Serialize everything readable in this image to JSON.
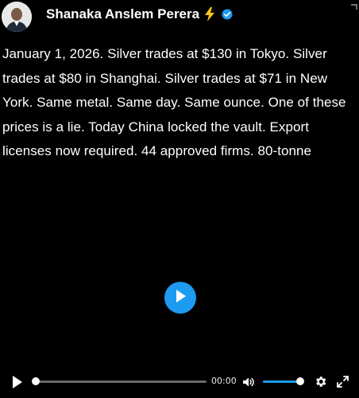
{
  "post": {
    "author_name": "Shanaka Anslem Perera",
    "text": "January 1, 2026. Silver trades at $130 in Tokyo. Silver trades at $80 in Shanghai. Silver trades at $71 in New York. Same metal. Same day. Same ounce. One of these prices is a lie. Today China locked the vault. Export licenses now required. 44 approved firms. 80-tonne"
  },
  "video": {
    "time": "00:00",
    "progress": 0.0,
    "volume": 1.0
  },
  "icons": {
    "author_badge": "lightning-bolt-icon",
    "verified": "verified-badge-icon",
    "play": "play-icon",
    "volume": "speaker-icon",
    "settings": "gear-icon",
    "fullscreen": "expand-icon"
  },
  "colors": {
    "accent": "#1d9bf0",
    "background": "#000000",
    "bolt": "#f5c518"
  }
}
